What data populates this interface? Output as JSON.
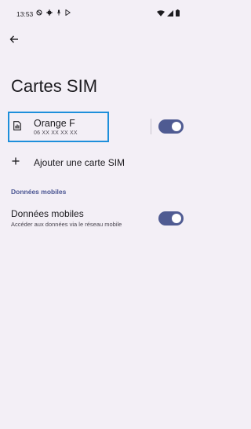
{
  "status_bar": {
    "time": "13:53"
  },
  "header": {
    "title": "Cartes SIM"
  },
  "sim": {
    "name": "Orange F",
    "number": "06 XX XX XX XX",
    "enabled": true
  },
  "add_sim": {
    "label": "Ajouter une carte SIM"
  },
  "mobile_data_section": {
    "header": "Données mobiles",
    "title": "Données mobiles",
    "subtitle": "Accéder aux données via le réseau mobile",
    "enabled": true
  },
  "colors": {
    "background": "#F3EFF6",
    "toggle_on": "#4F5B92",
    "highlight": "#1E8FDB",
    "section_header": "#4A5592"
  }
}
